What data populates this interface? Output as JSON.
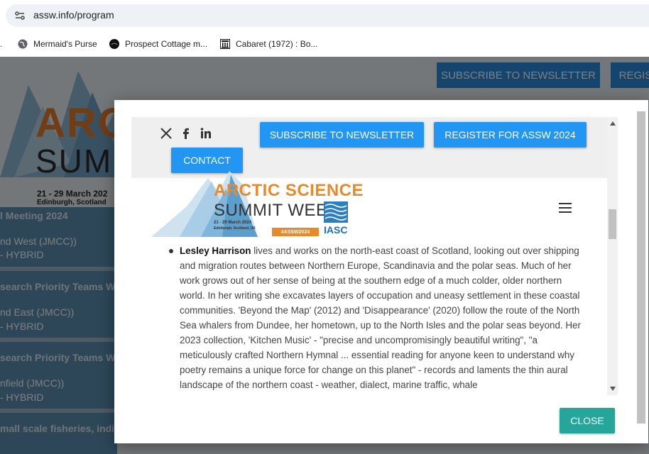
{
  "browser": {
    "url": "assw.info/program",
    "bookmarks": [
      {
        "label": "Mermaid's Purse",
        "icon": "globe-icon"
      },
      {
        "label": "Prospect Cottage m...",
        "icon": "site-favicon-icon"
      },
      {
        "label": "Cabaret (1972) : Bo...",
        "icon": "archive-favicon-icon"
      }
    ]
  },
  "background_page": {
    "logo_line1": "ARCT",
    "logo_line2": "SUMM",
    "logo_dates": "21 - 29 March 202",
    "logo_place": "Edinburgh, Scotland",
    "subscribe_label": "SUBSCRIBE TO NEWSLETTER",
    "register_label": "REGIS",
    "rows": [
      {
        "text": "l Meeting 2024",
        "head": true
      },
      {
        "text": "nd West (JMCC))",
        "head": false
      },
      {
        "text": "- HYBRID",
        "head": false
      },
      {
        "text": "search Priority Teams Wo",
        "head": true
      },
      {
        "text": "nd East (JMCC))",
        "head": false
      },
      {
        "text": "- HYBRID",
        "head": false
      },
      {
        "text": "search Priority Teams Wo",
        "head": true
      },
      {
        "text": "nfield (JMCC))",
        "head": false
      },
      {
        "text": "- HYBRID",
        "head": false
      },
      {
        "text": "mall scale fisheries, indige",
        "head": true
      }
    ]
  },
  "modal": {
    "social": [
      "x-icon",
      "facebook-icon",
      "linkedin-icon"
    ],
    "subscribe_label": "SUBSCRIBE TO NEWSLETTER",
    "register_label": "REGISTER FOR ASSW 2024",
    "contact_label": "CONTACT",
    "logo": {
      "line1": "ARCTIC SCIENCE",
      "line2": "SUMMIT WEEK",
      "dates": "21 - 29 March 2024",
      "place": "Edinburgh, Scotland, UK",
      "hashtag": "#ASSW2024",
      "org": "IASC"
    },
    "bio": {
      "name": "Lesley Harrison",
      "text": " lives and works on the north-east coast of Scotland, looking out over shipping and migration routes between Northern Europe, Scandinavia and the polar seas. Much of her work grows out of her sense of being at the southern edge of a much colder, older northern world. In her writing she excavates layers of occupation and uneasy settlement in these coastal communities. 'Beyond the Map' (2012) and 'Disappearance' (2020) follow the route of the North Sea whalers from Dundee, her hometown, up to the North Isles and the polar seas beyond. Her 2023 collection, 'Kitchen Music' - \"precise and uncompromisingly beautiful writing\", \"a meticulously crafted Northern Hymnal ... essential reading for anyone keen to understand why poetry remains a unique force for change on this planet\" - records and laments the thin aural landscape of the northern coast - weather, dialect, marine traffic, whale"
    },
    "close_label": "CLOSE"
  },
  "colors": {
    "button_blue": "#2196f3",
    "close_teal": "#26a69a",
    "brand_orange": "#e8892a"
  }
}
